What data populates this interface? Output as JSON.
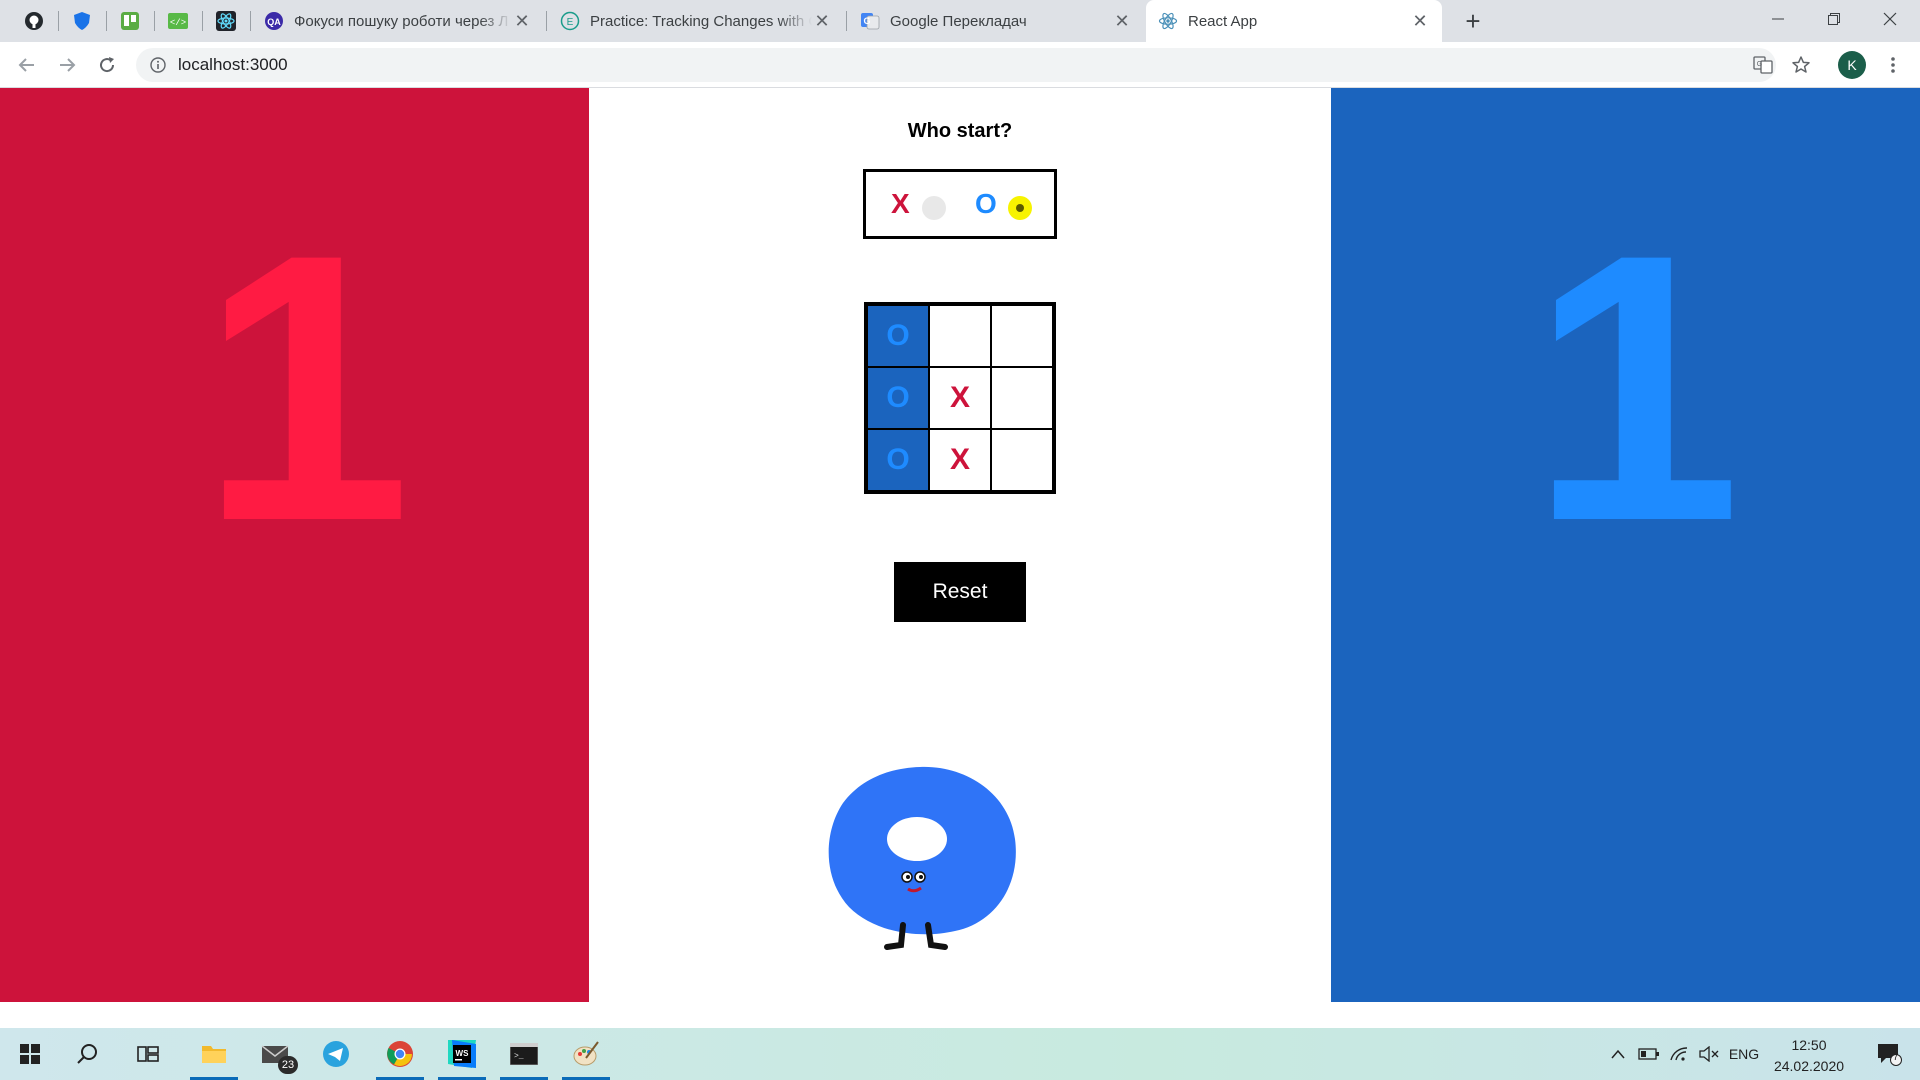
{
  "browser": {
    "pinned_tabs": [
      "github-icon",
      "shield-icon",
      "trello-icon",
      "code-sandbox-icon",
      "react-icon"
    ],
    "tabs": [
      {
        "title": "Фокуси пошуку роботи через Л",
        "icon": "qa-icon",
        "active": false
      },
      {
        "title": "Practice: Tracking Changes with C",
        "icon": "e-icon",
        "active": false
      },
      {
        "title": "Google Перекладач",
        "icon": "google-translate-icon",
        "active": false
      },
      {
        "title": "React App",
        "icon": "react-icon",
        "active": true
      }
    ],
    "url": "localhost:3000",
    "avatar_letter": "K"
  },
  "game": {
    "score_x": "1",
    "score_o": "1",
    "who_start_label": "Who start?",
    "chooser": {
      "x_label": "X",
      "o_label": "O",
      "selected": "O"
    },
    "board": [
      {
        "value": "O",
        "win": true
      },
      {
        "value": "",
        "win": false
      },
      {
        "value": "",
        "win": false
      },
      {
        "value": "O",
        "win": true
      },
      {
        "value": "X",
        "win": false
      },
      {
        "value": "",
        "win": false
      },
      {
        "value": "O",
        "win": true
      },
      {
        "value": "X",
        "win": false
      },
      {
        "value": "",
        "win": false
      }
    ],
    "reset_label": "Reset",
    "colors": {
      "x_panel": "#cd133b",
      "o_panel": "#1b64be",
      "x_score": "#ff1b43",
      "o_score": "#1e8bff"
    }
  },
  "taskbar": {
    "apps": [
      "start-icon",
      "search-icon",
      "task-view-icon",
      "file-explorer-icon",
      "mail-icon",
      "telegram-icon",
      "chrome-icon",
      "webstorm-icon",
      "terminal-icon",
      "paint-icon"
    ],
    "mail_badge": "23",
    "language": "ENG",
    "time": "12:50",
    "date": "24.02.2020",
    "notifications_count": "7"
  }
}
